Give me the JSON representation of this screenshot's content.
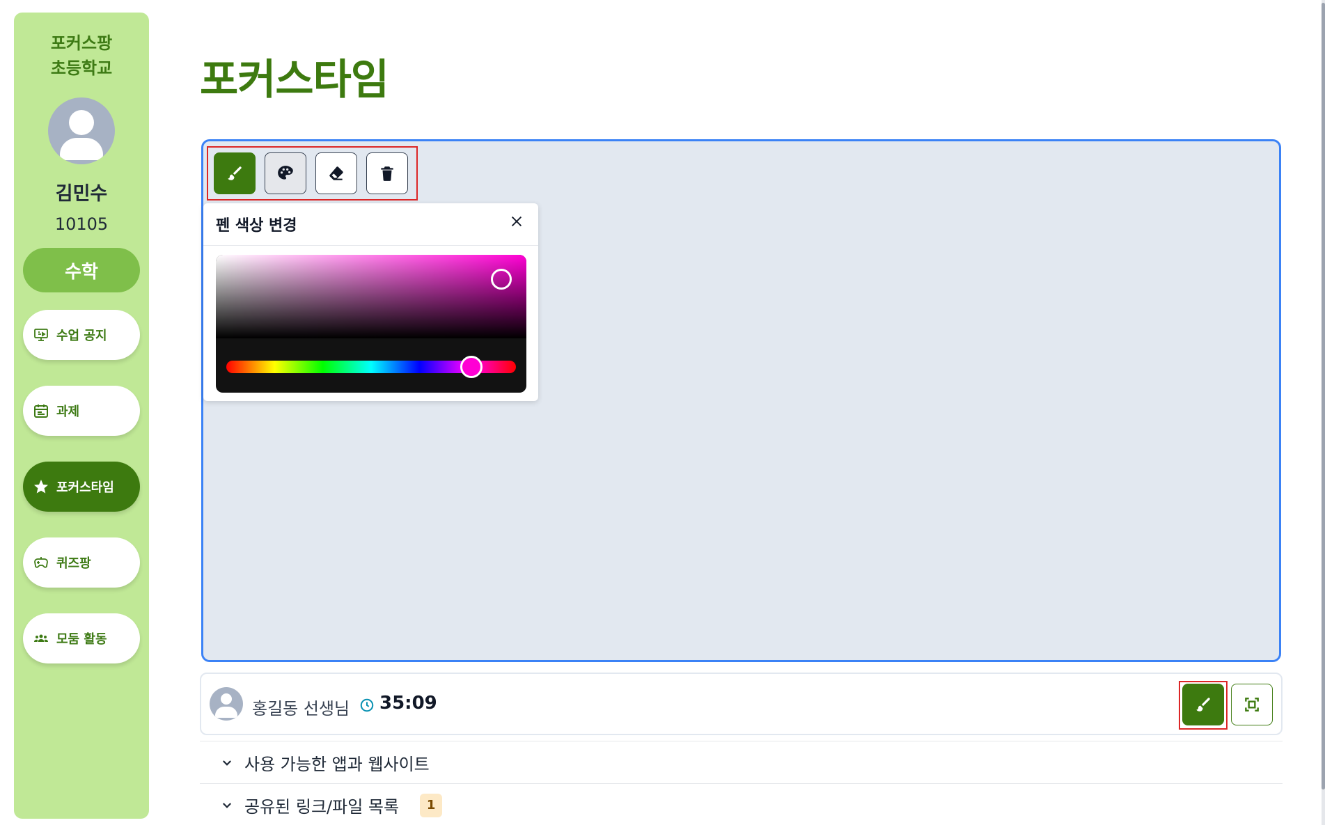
{
  "sidebar": {
    "school": "포커스팡\n초등학교",
    "student_name": "김민수",
    "student_id": "10105",
    "subject": "수학",
    "items": [
      {
        "label": "수업 공지",
        "icon": "monitor-icon"
      },
      {
        "label": "과제",
        "icon": "calendar-icon"
      },
      {
        "label": "포커스타임",
        "icon": "star-icon",
        "active": true
      },
      {
        "label": "퀴즈팡",
        "icon": "gamepad-icon"
      },
      {
        "label": "모둠 활동",
        "icon": "group-icon"
      }
    ]
  },
  "page": {
    "title": "포커스타임"
  },
  "toolbar": {
    "tools": [
      {
        "name": "brush",
        "icon": "brush-icon",
        "active": true
      },
      {
        "name": "palette",
        "icon": "palette-icon"
      },
      {
        "name": "eraser",
        "icon": "eraser-icon"
      },
      {
        "name": "trash",
        "icon": "trash-icon"
      }
    ]
  },
  "color_popup": {
    "title": "펜 색상 변경",
    "selected_color": "#ff00d4",
    "hue_position": 0.86
  },
  "session": {
    "teacher": "홍길동 선생님",
    "timer": "35:09"
  },
  "accordions": [
    {
      "label": "사용 가능한 앱과 웹사이트"
    },
    {
      "label": "공유된 링크/파일 목록",
      "badge": "1"
    }
  ],
  "colors": {
    "sidebar_bg": "#c0e896",
    "primary": "#3d7a0f",
    "canvas_bg": "#e2e8f0",
    "canvas_border": "#3b82f6",
    "highlight": "#dc2626"
  }
}
